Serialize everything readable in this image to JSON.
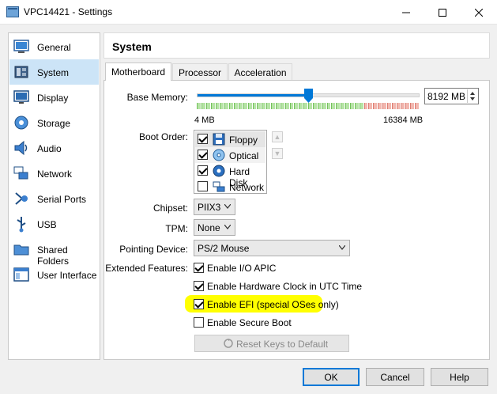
{
  "window": {
    "title": "VPC14421 - Settings"
  },
  "sidebar": {
    "items": [
      {
        "label": "General",
        "icon": "general-icon"
      },
      {
        "label": "System",
        "icon": "system-icon"
      },
      {
        "label": "Display",
        "icon": "display-icon"
      },
      {
        "label": "Storage",
        "icon": "storage-icon"
      },
      {
        "label": "Audio",
        "icon": "audio-icon"
      },
      {
        "label": "Network",
        "icon": "network-icon"
      },
      {
        "label": "Serial Ports",
        "icon": "serial-ports-icon"
      },
      {
        "label": "USB",
        "icon": "usb-icon"
      },
      {
        "label": "Shared Folders",
        "icon": "shared-folders-icon"
      },
      {
        "label": "User Interface",
        "icon": "user-interface-icon"
      }
    ],
    "selected": "System"
  },
  "header": {
    "title": "System"
  },
  "tabs": [
    {
      "label": "Motherboard",
      "active": true
    },
    {
      "label": "Processor",
      "active": false
    },
    {
      "label": "Acceleration",
      "active": false
    }
  ],
  "motherboard": {
    "base_memory": {
      "label": "Base Memory:",
      "value": "8192 MB",
      "value_mb": 8192,
      "min_label": "4 MB",
      "max_label": "16384 MB",
      "fraction": 0.5
    },
    "boot_order": {
      "label": "Boot Order:",
      "items": [
        {
          "label": "Floppy",
          "checked": true,
          "icon": "floppy-icon"
        },
        {
          "label": "Optical",
          "checked": true,
          "icon": "optical-icon"
        },
        {
          "label": "Hard Disk",
          "checked": true,
          "icon": "hard-disk-icon"
        },
        {
          "label": "Network",
          "checked": false,
          "icon": "network-boot-icon"
        }
      ]
    },
    "chipset": {
      "label": "Chipset:",
      "value": "PIIX3"
    },
    "tpm": {
      "label": "TPM:",
      "value": "None"
    },
    "pointing_device": {
      "label": "Pointing Device:",
      "value": "PS/2 Mouse"
    },
    "extended_features": {
      "label": "Extended Features:",
      "items": [
        {
          "label": "Enable I/O APIC",
          "checked": true
        },
        {
          "label": "Enable Hardware Clock in UTC Time",
          "checked": true
        },
        {
          "label": "Enable EFI (special OSes only)",
          "checked": true,
          "highlighted": true
        },
        {
          "label": "Enable Secure Boot",
          "checked": false
        }
      ]
    },
    "reset_keys_label": "Reset Keys to Default"
  },
  "buttons": {
    "ok": "OK",
    "cancel": "Cancel",
    "help": "Help"
  },
  "colors": {
    "accent": "#0078d7",
    "selection": "#cce4f7",
    "highlight": "#ffff00"
  }
}
